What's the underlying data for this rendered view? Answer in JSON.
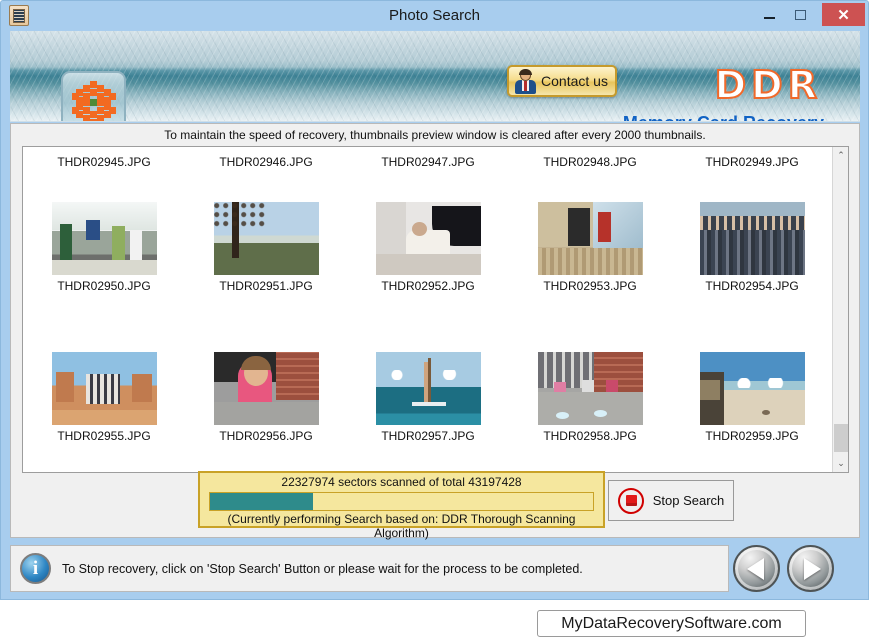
{
  "window": {
    "title": "Photo Search",
    "app_icon": "memory-card-icon",
    "minimize_label": "",
    "maximize_label": "",
    "close_label": "✕"
  },
  "banner": {
    "logo_button_icon": "checkered-flower-logo",
    "contact_button_label": "Contact us",
    "contact_button_icon": "person-avatar-icon",
    "brand": "DDR",
    "tagline": "Memory Card Recovery",
    "brand_color": "#f0692a",
    "tagline_color": "#1163c4"
  },
  "content": {
    "notice": "To maintain the speed of recovery, thumbnails preview window is cleared after every 2000 thumbnails.",
    "rows": [
      {
        "label_position": "above",
        "items": [
          {
            "name": "THDR02945.JPG"
          },
          {
            "name": "THDR02946.JPG"
          },
          {
            "name": "THDR02947.JPG"
          },
          {
            "name": "THDR02948.JPG"
          },
          {
            "name": "THDR02949.JPG"
          }
        ]
      },
      {
        "label_position": "below",
        "items": [
          {
            "name": "THDR02950.JPG"
          },
          {
            "name": "THDR02951.JPG"
          },
          {
            "name": "THDR02952.JPG"
          },
          {
            "name": "THDR02953.JPG"
          },
          {
            "name": "THDR02954.JPG"
          }
        ]
      },
      {
        "label_position": "below",
        "items": [
          {
            "name": "THDR02955.JPG"
          },
          {
            "name": "THDR02956.JPG"
          },
          {
            "name": "THDR02957.JPG"
          },
          {
            "name": "THDR02958.JPG"
          },
          {
            "name": "THDR02959.JPG"
          }
        ]
      }
    ],
    "scrollbar": {
      "up_arrow": "⌃",
      "down_arrow": "⌄"
    }
  },
  "progress": {
    "sectors_text": "22327974 sectors scanned of total 43197428",
    "percent": 27,
    "fill_color": "#2e8b8b",
    "note": "(Currently performing Search based on:  DDR Thorough Scanning Algorithm)"
  },
  "stop_button": {
    "label": "Stop Search",
    "icon": "stop-square-icon"
  },
  "footer": {
    "info_icon": "i",
    "message": "To Stop recovery, click on 'Stop Search' Button or please wait for the process to be completed.",
    "prev_label": "",
    "next_label": ""
  },
  "url_bar": {
    "text": "MyDataRecoverySoftware.com"
  }
}
